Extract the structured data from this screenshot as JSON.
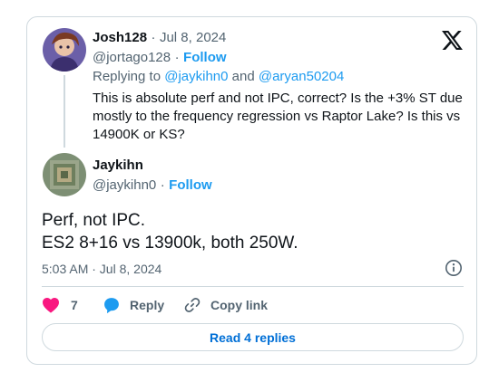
{
  "reply_to_tweet": {
    "display_name": "Josh128",
    "date": "Jul 8, 2024",
    "handle": "@jortago128",
    "follow_label": "Follow",
    "replying_prefix": "Replying to",
    "reply_handle_1": "@jaykihn0",
    "and_word": "and",
    "reply_handle_2": "@aryan50204",
    "text_lines": [
      "This is absolute perf and not IPC, correct?  Is the +3% ST due",
      "mostly to the frequency regression vs Raptor Lake?  Is this vs",
      "14900K or KS?"
    ]
  },
  "main_tweet": {
    "display_name": "Jaykihn",
    "handle": "@jaykihn0",
    "follow_label": "Follow",
    "text_lines": [
      "Perf, not IPC.",
      "ES2 8+16 vs 13900k, both 250W."
    ],
    "timestamp": "5:03 AM · Jul 8, 2024"
  },
  "separator_dot": "·",
  "actions": {
    "like_count": "7",
    "reply_label": "Reply",
    "copy_link_label": "Copy link"
  },
  "read_replies_label": "Read 4 replies",
  "colors": {
    "accent": "#1d9bf0",
    "heart": "#f91880",
    "muted": "#536471",
    "border": "#cfd9de"
  },
  "icons": [
    "x-logo-icon",
    "heart-icon",
    "reply-bubble-icon",
    "link-icon",
    "info-icon"
  ]
}
